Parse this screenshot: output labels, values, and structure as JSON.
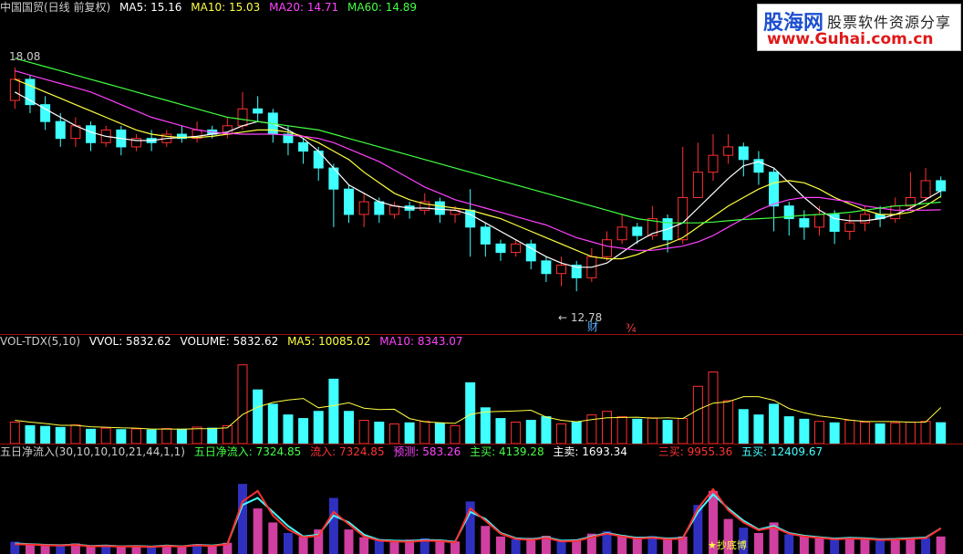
{
  "header": {
    "title": "中国国贸(日线 前复权)",
    "items": [
      {
        "label": "MA5: 15.16",
        "color": "#ffffff"
      },
      {
        "label": "MA10: 15.03",
        "color": "#ffff40"
      },
      {
        "label": "MA20: 14.71",
        "color": "#ff40ff"
      },
      {
        "label": "MA60: 14.89",
        "color": "#40ff40"
      }
    ]
  },
  "banner": {
    "line1a": "股海网",
    "line1b": "股票软件资源分享",
    "line2": "www.Guhai.com.cn"
  },
  "annotations": {
    "high": "18.08",
    "low": "← 12.78",
    "marker1": "财",
    "marker2": "¾"
  },
  "vol_header": {
    "items": [
      {
        "label": "VOL-TDX(5,10)",
        "color": "#cccccc"
      },
      {
        "label": "VVOL: 5832.62",
        "color": "#ffffff"
      },
      {
        "label": "VOLUME: 5832.62",
        "color": "#ffffff"
      },
      {
        "label": "MA5: 10085.02",
        "color": "#ffff40"
      },
      {
        "label": "MA10: 8343.07",
        "color": "#ff40ff"
      }
    ]
  },
  "ind_header": {
    "items": [
      {
        "label": "五日净流入(30,10,10,10,21,44,1,1)",
        "color": "#cccccc"
      },
      {
        "label": "五日净流入: 7324.85",
        "color": "#40ff40"
      },
      {
        "label": "流入: 7324.85",
        "color": "#ff3030"
      },
      {
        "label": "预测: 583.26",
        "color": "#ff40ff"
      },
      {
        "label": "主买: 4139.28",
        "color": "#40ff40"
      },
      {
        "label": "主卖: 1693.34",
        "color": "#ffffff"
      },
      {
        "label": "三买: 9955.36",
        "color": "#ff3030"
      },
      {
        "label": "五买: 12409.67",
        "color": "#40ffff"
      }
    ]
  },
  "footer_label": "★抄底博",
  "chart_data": {
    "type": "candlestick",
    "price_range": [
      12.2,
      18.9
    ],
    "candles": [
      [
        17.3,
        17.8,
        18.08,
        17.1
      ],
      [
        17.8,
        17.2,
        17.9,
        17.0
      ],
      [
        17.2,
        16.8,
        17.4,
        16.6
      ],
      [
        16.8,
        16.4,
        17.0,
        16.2
      ],
      [
        16.4,
        16.7,
        16.9,
        16.2
      ],
      [
        16.7,
        16.3,
        16.8,
        16.1
      ],
      [
        16.3,
        16.6,
        16.7,
        16.2
      ],
      [
        16.6,
        16.2,
        16.7,
        16.0
      ],
      [
        16.2,
        16.4,
        16.5,
        16.1
      ],
      [
        16.4,
        16.3,
        16.6,
        16.1
      ],
      [
        16.3,
        16.5,
        16.6,
        16.2
      ],
      [
        16.5,
        16.4,
        16.7,
        16.3
      ],
      [
        16.4,
        16.6,
        16.8,
        16.3
      ],
      [
        16.6,
        16.5,
        16.7,
        16.4
      ],
      [
        16.5,
        16.7,
        16.9,
        16.4
      ],
      [
        16.7,
        17.1,
        17.5,
        16.6
      ],
      [
        17.1,
        17.0,
        17.4,
        16.8
      ],
      [
        17.0,
        16.5,
        17.1,
        16.3
      ],
      [
        16.5,
        16.3,
        16.7,
        16.0
      ],
      [
        16.3,
        16.1,
        16.4,
        15.8
      ],
      [
        16.1,
        15.7,
        16.2,
        15.4
      ],
      [
        15.7,
        15.2,
        15.8,
        14.3
      ],
      [
        15.2,
        14.6,
        15.3,
        14.4
      ],
      [
        14.6,
        14.9,
        15.1,
        14.3
      ],
      [
        14.9,
        14.6,
        15.0,
        14.4
      ],
      [
        14.6,
        14.8,
        14.9,
        14.5
      ],
      [
        14.8,
        14.7,
        14.9,
        14.5
      ],
      [
        14.7,
        14.9,
        15.1,
        14.6
      ],
      [
        14.9,
        14.6,
        15.0,
        14.4
      ],
      [
        14.6,
        14.7,
        14.8,
        14.4
      ],
      [
        14.7,
        14.3,
        15.2,
        13.6
      ],
      [
        14.3,
        13.9,
        14.4,
        13.6
      ],
      [
        13.9,
        13.7,
        14.0,
        13.5
      ],
      [
        13.7,
        13.9,
        14.0,
        13.6
      ],
      [
        13.9,
        13.5,
        14.0,
        13.3
      ],
      [
        13.5,
        13.2,
        13.6,
        13.0
      ],
      [
        13.2,
        13.4,
        13.6,
        12.9
      ],
      [
        13.4,
        13.1,
        13.5,
        12.78
      ],
      [
        13.1,
        13.6,
        13.8,
        13.0
      ],
      [
        13.6,
        14.0,
        14.2,
        13.5
      ],
      [
        14.0,
        14.3,
        14.6,
        13.9
      ],
      [
        14.3,
        14.1,
        14.4,
        13.9
      ],
      [
        14.1,
        14.5,
        14.8,
        14.0
      ],
      [
        14.5,
        14.0,
        14.6,
        13.7
      ],
      [
        14.0,
        15.0,
        16.2,
        13.9
      ],
      [
        15.0,
        15.6,
        16.3,
        15.0
      ],
      [
        15.6,
        16.0,
        16.5,
        15.4
      ],
      [
        16.0,
        16.2,
        16.5,
        15.8
      ],
      [
        16.2,
        15.9,
        16.3,
        15.5
      ],
      [
        15.9,
        15.6,
        16.1,
        15.3
      ],
      [
        15.6,
        14.8,
        15.7,
        14.2
      ],
      [
        14.8,
        14.5,
        14.9,
        14.1
      ],
      [
        14.5,
        14.3,
        14.7,
        14.0
      ],
      [
        14.3,
        14.6,
        14.8,
        14.1
      ],
      [
        14.6,
        14.2,
        14.7,
        13.9
      ],
      [
        14.2,
        14.4,
        14.6,
        14.0
      ],
      [
        14.4,
        14.6,
        14.8,
        14.2
      ],
      [
        14.6,
        14.5,
        14.8,
        14.3
      ],
      [
        14.5,
        14.8,
        15.0,
        14.4
      ],
      [
        14.8,
        15.0,
        15.6,
        14.7
      ],
      [
        15.0,
        15.4,
        15.7,
        14.9
      ],
      [
        15.4,
        15.16,
        15.5,
        15.0
      ]
    ],
    "ma_series": [
      {
        "name": "MA5",
        "color": "#ffffff",
        "values": [
          17.5,
          17.3,
          17.1,
          16.9,
          16.7,
          16.55,
          16.45,
          16.4,
          16.35,
          16.35,
          16.4,
          16.42,
          16.45,
          16.5,
          16.55,
          16.7,
          16.8,
          16.75,
          16.6,
          16.4,
          16.1,
          15.7,
          15.3,
          15.1,
          14.9,
          14.8,
          14.75,
          14.75,
          14.72,
          14.7,
          14.6,
          14.4,
          14.2,
          14.0,
          13.8,
          13.6,
          13.45,
          13.35,
          13.35,
          13.45,
          13.7,
          13.95,
          14.15,
          14.25,
          14.4,
          14.75,
          15.1,
          15.45,
          15.75,
          15.85,
          15.7,
          15.35,
          15.0,
          14.7,
          14.5,
          14.45,
          14.45,
          14.5,
          14.6,
          14.75,
          14.95,
          15.16
        ]
      },
      {
        "name": "MA10",
        "color": "#ffff40",
        "values": [
          17.8,
          17.65,
          17.5,
          17.35,
          17.2,
          17.05,
          16.9,
          16.75,
          16.6,
          16.5,
          16.45,
          16.42,
          16.42,
          16.45,
          16.5,
          16.55,
          16.6,
          16.6,
          16.55,
          16.45,
          16.3,
          16.1,
          15.9,
          15.6,
          15.35,
          15.1,
          14.95,
          14.85,
          14.8,
          14.75,
          14.7,
          14.6,
          14.5,
          14.35,
          14.2,
          14.05,
          13.9,
          13.75,
          13.6,
          13.55,
          13.55,
          13.65,
          13.8,
          13.9,
          14.05,
          14.3,
          14.55,
          14.8,
          15.0,
          15.2,
          15.35,
          15.4,
          15.35,
          15.2,
          15.0,
          14.85,
          14.7,
          14.6,
          14.6,
          14.65,
          14.8,
          15.03
        ]
      },
      {
        "name": "MA20",
        "color": "#ff40ff",
        "values": [
          18.0,
          17.9,
          17.8,
          17.7,
          17.6,
          17.5,
          17.35,
          17.2,
          17.05,
          16.9,
          16.8,
          16.7,
          16.6,
          16.55,
          16.52,
          16.5,
          16.5,
          16.5,
          16.48,
          16.45,
          16.4,
          16.3,
          16.15,
          16.0,
          15.85,
          15.65,
          15.45,
          15.25,
          15.1,
          14.95,
          14.85,
          14.75,
          14.65,
          14.55,
          14.45,
          14.35,
          14.2,
          14.05,
          13.95,
          13.85,
          13.8,
          13.75,
          13.75,
          13.8,
          13.85,
          13.95,
          14.1,
          14.3,
          14.5,
          14.7,
          14.85,
          14.95,
          15.0,
          15.0,
          14.95,
          14.9,
          14.8,
          14.75,
          14.7,
          14.7,
          14.7,
          14.71
        ]
      },
      {
        "name": "MA60",
        "color": "#40ff40",
        "values": [
          18.3,
          18.2,
          18.1,
          18.0,
          17.9,
          17.8,
          17.7,
          17.6,
          17.5,
          17.4,
          17.3,
          17.2,
          17.1,
          17.0,
          16.9,
          16.85,
          16.8,
          16.75,
          16.7,
          16.65,
          16.6,
          16.5,
          16.4,
          16.3,
          16.2,
          16.1,
          16.0,
          15.9,
          15.8,
          15.7,
          15.6,
          15.5,
          15.4,
          15.3,
          15.2,
          15.1,
          15.0,
          14.9,
          14.8,
          14.7,
          14.6,
          14.5,
          14.45,
          14.4,
          14.4,
          14.4,
          14.42,
          14.45,
          14.48,
          14.5,
          14.52,
          14.55,
          14.58,
          14.6,
          14.62,
          14.65,
          14.7,
          14.75,
          14.8,
          14.82,
          14.86,
          14.89
        ]
      }
    ],
    "volume": {
      "max": 25000,
      "values": [
        6000,
        5000,
        4800,
        4500,
        5200,
        4000,
        4300,
        3900,
        4100,
        3800,
        4200,
        4000,
        4600,
        4300,
        5000,
        22000,
        15000,
        11000,
        8000,
        7000,
        9000,
        18000,
        9000,
        6500,
        6000,
        5500,
        5800,
        6200,
        5700,
        5000,
        17000,
        10000,
        7000,
        6000,
        6500,
        7500,
        5500,
        6000,
        8000,
        9000,
        7500,
        6800,
        7200,
        6500,
        7000,
        16000,
        20000,
        12000,
        9500,
        8000,
        11000,
        7500,
        6800,
        6200,
        5800,
        6500,
        6000,
        5500,
        5800,
        6000,
        6200,
        5832.62
      ],
      "ma5": [
        6500,
        6000,
        5600,
        5100,
        5100,
        4700,
        4560,
        4380,
        4300,
        4060,
        4060,
        4000,
        4140,
        4180,
        4420,
        8100,
        10200,
        11500,
        12200,
        12600,
        10000,
        10600,
        11400,
        9900,
        9500,
        9600,
        7000,
        6100,
        5840,
        5640,
        8140,
        8880,
        8980,
        9140,
        9300,
        7400,
        6500,
        6100,
        6700,
        7200,
        7300,
        7360,
        7100,
        7200,
        7000,
        9500,
        11300,
        11700,
        13100,
        13100,
        12100,
        9800,
        8600,
        7700,
        7200,
        6560,
        6160,
        6160,
        6140,
        5960,
        6000,
        10085
      ]
    },
    "indicator": {
      "max": 25000,
      "series": [
        {
          "name": "五日净流入",
          "color": "#40ffff",
          "values": [
            3000,
            2800,
            2600,
            2500,
            2700,
            2300,
            2400,
            2200,
            2300,
            2100,
            2400,
            2200,
            2600,
            2400,
            2900,
            14000,
            16000,
            12000,
            8000,
            5000,
            5500,
            11000,
            9000,
            5500,
            4000,
            3800,
            3700,
            4000,
            3900,
            3500,
            12000,
            10000,
            6000,
            4500,
            4200,
            4800,
            3800,
            3900,
            5000,
            6000,
            5200,
            4600,
            4800,
            4400,
            4600,
            12000,
            17000,
            13000,
            9500,
            7000,
            8000,
            6000,
            5200,
            4800,
            4400,
            4600,
            4500,
            4200,
            4300,
            4500,
            4700,
            7324.85
          ]
        },
        {
          "name": "流入",
          "color": "#ff3030",
          "values": [
            2800,
            2700,
            2500,
            2400,
            2600,
            2200,
            2300,
            2100,
            2200,
            2000,
            2300,
            2100,
            2500,
            2300,
            2800,
            15000,
            18000,
            11000,
            7000,
            4800,
            5200,
            12000,
            8500,
            5000,
            3800,
            3600,
            3500,
            3800,
            3700,
            3300,
            13000,
            9500,
            5800,
            4300,
            4000,
            4600,
            3600,
            3700,
            4800,
            5800,
            5000,
            4400,
            4600,
            4200,
            4400,
            13000,
            18500,
            12500,
            9000,
            6800,
            7600,
            5800,
            5000,
            4600,
            4200,
            4400,
            4300,
            4000,
            4100,
            4300,
            4500,
            7324.85
          ]
        }
      ],
      "bars": [
        3500,
        3000,
        2800,
        2600,
        3000,
        2400,
        2600,
        2300,
        2400,
        2200,
        2600,
        2400,
        2800,
        2600,
        3200,
        20000,
        13000,
        9000,
        6000,
        5000,
        7000,
        16000,
        7000,
        4800,
        4200,
        4000,
        4100,
        4500,
        4000,
        3600,
        15000,
        8000,
        5000,
        4200,
        4600,
        5200,
        3900,
        4200,
        5800,
        6500,
        5400,
        4900,
        5100,
        4700,
        5000,
        14000,
        18000,
        10000,
        7500,
        6000,
        9000,
        5600,
        5000,
        4500,
        4200,
        4700,
        4400,
        4000,
        4200,
        4400,
        4600,
        5000
      ]
    }
  }
}
